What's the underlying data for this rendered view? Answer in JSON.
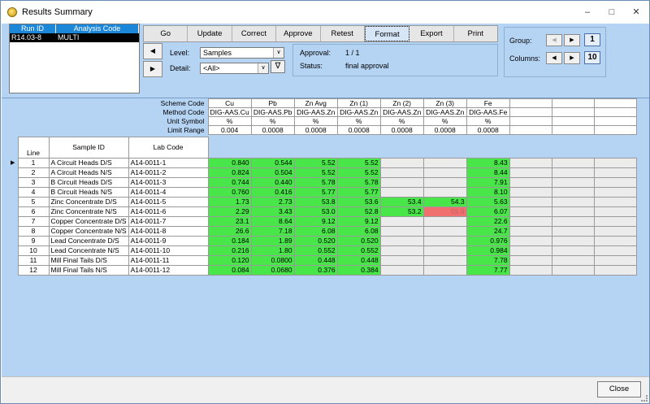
{
  "window": {
    "title": "Results Summary",
    "minimize_glyph": "–",
    "restore_glyph": "□",
    "close_glyph": "✕"
  },
  "runs": {
    "headers": [
      "Run ID",
      "Analysis Code"
    ],
    "rows": [
      {
        "run_id": "R14.03-8",
        "analysis_code": "MULTI"
      }
    ]
  },
  "toolbar": {
    "buttons": [
      "Go",
      "Update",
      "Correct",
      "Approve",
      "Retest",
      "Format",
      "Export",
      "Print"
    ]
  },
  "nav": {
    "left_glyph": "◀",
    "right_glyph": "▶"
  },
  "filters": {
    "level_label": "Level:",
    "level_value": "Samples",
    "detail_label": "Detail:",
    "detail_value": "<All>",
    "dropdown_glyph": "∨",
    "filter_glyph": "∇"
  },
  "status": {
    "approval_label": "Approval:",
    "approval_value": "1 / 1",
    "status_label": "Status:",
    "status_value": "final approval"
  },
  "grouping": {
    "group_label": "Group:",
    "group_value": "1",
    "columns_label": "Columns:",
    "columns_value": "10",
    "left_glyph": "◀",
    "right_glyph": "▶"
  },
  "meta": {
    "row_labels": [
      "Scheme Code",
      "Method Code",
      "Unit Symbol",
      "Limit Range"
    ],
    "columns": [
      {
        "scheme": "Cu",
        "method": "DIG-AAS.Cu",
        "unit": "%",
        "limit": "0.004"
      },
      {
        "scheme": "Pb",
        "method": "DIG-AAS.Pb",
        "unit": "%",
        "limit": "0.0008"
      },
      {
        "scheme": "Zn Avg",
        "method": "DIG-AAS.Zn",
        "unit": "%",
        "limit": "0.0008"
      },
      {
        "scheme": "Zn (1)",
        "method": "DIG-AAS.Zn",
        "unit": "%",
        "limit": "0.0008"
      },
      {
        "scheme": "Zn (2)",
        "method": "DIG-AAS.Zn",
        "unit": "%",
        "limit": "0.0008"
      },
      {
        "scheme": "Zn (3)",
        "method": "DIG-AAS.Zn",
        "unit": "%",
        "limit": "0.0008"
      },
      {
        "scheme": "Fe",
        "method": "DIG-AAS.Fe",
        "unit": "%",
        "limit": "0.0008"
      }
    ]
  },
  "grid": {
    "headers": {
      "line": "Line",
      "sample_id": "Sample ID",
      "lab_code": "Lab Code"
    },
    "selector_glyph": "▶",
    "rows": [
      {
        "line": "1",
        "sample": "A Circuit Heads D/S",
        "lab": "A14-0011-1",
        "v": [
          "0.840",
          "0.544",
          "5.52",
          "5.52",
          "",
          "",
          "8.43"
        ]
      },
      {
        "line": "2",
        "sample": "A Circuit Heads N/S",
        "lab": "A14-0011-2",
        "v": [
          "0.824",
          "0.504",
          "5.52",
          "5.52",
          "",
          "",
          "8.44"
        ]
      },
      {
        "line": "3",
        "sample": "B Circuit Heads D/S",
        "lab": "A14-0011-3",
        "v": [
          "0.744",
          "0.440",
          "5.78",
          "5.78",
          "",
          "",
          "7.91"
        ]
      },
      {
        "line": "4",
        "sample": "B Circuit Heads N/S",
        "lab": "A14-0011-4",
        "v": [
          "0.760",
          "0.416",
          "5.77",
          "5.77",
          "",
          "",
          "8.10"
        ]
      },
      {
        "line": "5",
        "sample": "Zinc Concentrate D/S",
        "lab": "A14-0011-5",
        "v": [
          "1.73",
          "2.73",
          "53.8",
          "53.6",
          "53.4",
          "54.3",
          "5.63"
        ]
      },
      {
        "line": "6",
        "sample": "Zinc Concentrate N/S",
        "lab": "A14-0011-6",
        "v": [
          "2.29",
          "3.43",
          "53.0",
          "52.8",
          "53.2",
          "55.9",
          "6.07"
        ]
      },
      {
        "line": "7",
        "sample": "Copper Concentrate D/S",
        "lab": "A14-0011-7",
        "v": [
          "23.1",
          "8.64",
          "9.12",
          "9.12",
          "",
          "",
          "22.6"
        ]
      },
      {
        "line": "8",
        "sample": "Copper Concentrate N/S",
        "lab": "A14-0011-8",
        "v": [
          "26.6",
          "7.18",
          "6.08",
          "6.08",
          "",
          "",
          "24.7"
        ]
      },
      {
        "line": "9",
        "sample": "Lead Concentrate D/S",
        "lab": "A14-0011-9",
        "v": [
          "0.184",
          "1.89",
          "0.520",
          "0.520",
          "",
          "",
          "0.976"
        ]
      },
      {
        "line": "10",
        "sample": "Lead Concentrate N/S",
        "lab": "A14-0011-10",
        "v": [
          "0.216",
          "1.80",
          "0.552",
          "0.552",
          "",
          "",
          "0.984"
        ]
      },
      {
        "line": "11",
        "sample": "Mill Final Tails D/S",
        "lab": "A14-0011-11",
        "v": [
          "0.120",
          "0.0800",
          "0.448",
          "0.448",
          "",
          "",
          "7.78"
        ]
      },
      {
        "line": "12",
        "sample": "Mill Final Tails N/S",
        "lab": "A14-0011-12",
        "v": [
          "0.084",
          "0.0680",
          "0.376",
          "0.384",
          "",
          "",
          "7.77"
        ]
      }
    ]
  },
  "colors": {
    "pass": "#49e649",
    "fail": "#f07070",
    "empty": "#ececec",
    "background": "#b5d3f3"
  },
  "footer": {
    "close_label": "Close"
  }
}
